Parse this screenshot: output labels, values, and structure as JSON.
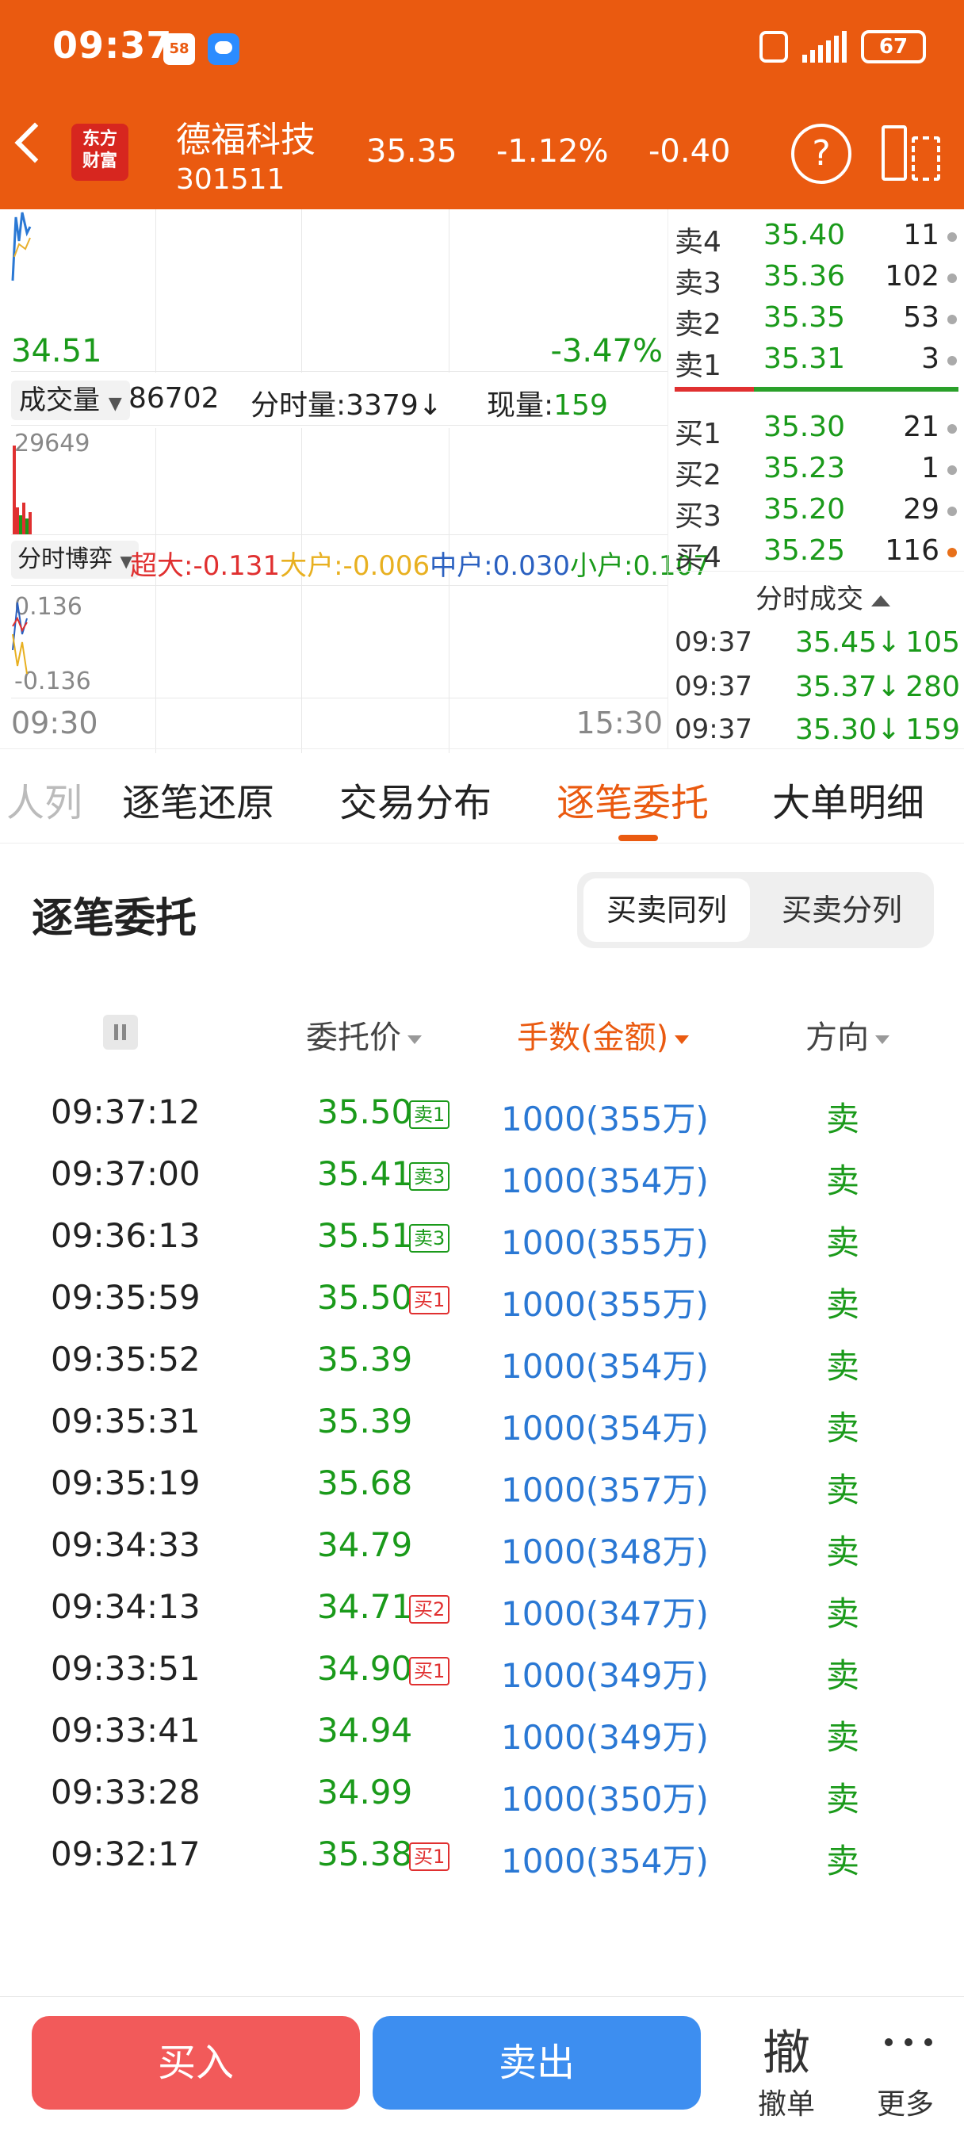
{
  "status_bar": {
    "time": "09:37",
    "app_badge": "58",
    "battery": "67"
  },
  "header": {
    "logo_line1": "东方",
    "logo_line2": "财富",
    "stock_name": "德福科技",
    "stock_code": "301511",
    "price": "35.35",
    "change_pct": "-1.12%",
    "change": "-0.40",
    "help_symbol": "?"
  },
  "chart": {
    "low_price": "34.51",
    "low_pct": "-3.47%",
    "volume_label": "成交量",
    "volume_total": "86702",
    "tick_volume": "分时量:3379",
    "tick_arrow": "↓",
    "now_volume_label": "现量:",
    "now_volume": "159",
    "volume_max": "29649",
    "game_label": "分时博弈",
    "game": {
      "super_label": "超大:",
      "super_val": "-0.131",
      "large_label": "大户:",
      "large_val": "-0.006",
      "mid_label": "中户:",
      "mid_val": "0.030",
      "small_label": "小户:",
      "small_val": "0.107"
    },
    "tick_up": "0.136",
    "tick_down": "-0.136",
    "time_start": "09:30",
    "time_end": "15:30"
  },
  "order_book": {
    "asks": [
      {
        "label": "卖4",
        "price": "35.40",
        "qty": "11"
      },
      {
        "label": "卖3",
        "price": "35.36",
        "qty": "102"
      },
      {
        "label": "卖2",
        "price": "35.35",
        "qty": "53"
      },
      {
        "label": "卖1",
        "price": "35.31",
        "qty": "3"
      }
    ],
    "bids": [
      {
        "label": "买1",
        "price": "35.30",
        "qty": "21"
      },
      {
        "label": "买2",
        "price": "35.23",
        "qty": "1"
      },
      {
        "label": "买3",
        "price": "35.20",
        "qty": "29"
      },
      {
        "label": "买4",
        "price": "35.25",
        "qty": "116"
      }
    ],
    "trades_title": "分时成交",
    "trades": [
      {
        "time": "09:37",
        "price": "35.45↓",
        "qty": "105"
      },
      {
        "time": "09:37",
        "price": "35.37↓",
        "qty": "280"
      },
      {
        "time": "09:37",
        "price": "35.30↓",
        "qty": "159"
      }
    ]
  },
  "tabs": [
    "队列",
    "逐笔还原",
    "交易分布",
    "逐笔委托",
    "大单明细"
  ],
  "tab_partial": "人列",
  "section": {
    "title": "逐笔委托",
    "seg_same": "买卖同列",
    "seg_split": "买卖分列",
    "col_price": "委托价",
    "col_qty": "手数(金额)",
    "col_dir": "方向"
  },
  "orders": [
    {
      "time": "09:37:12",
      "price": "35.50",
      "badge": "卖1",
      "badge_type": "s",
      "amount": "1000(355万)",
      "dir": "卖"
    },
    {
      "time": "09:37:00",
      "price": "35.41",
      "badge": "卖3",
      "badge_type": "s",
      "amount": "1000(354万)",
      "dir": "卖"
    },
    {
      "time": "09:36:13",
      "price": "35.51",
      "badge": "卖3",
      "badge_type": "s",
      "amount": "1000(355万)",
      "dir": "卖"
    },
    {
      "time": "09:35:59",
      "price": "35.50",
      "badge": "买1",
      "badge_type": "b",
      "amount": "1000(355万)",
      "dir": "卖"
    },
    {
      "time": "09:35:52",
      "price": "35.39",
      "badge": "",
      "badge_type": "",
      "amount": "1000(354万)",
      "dir": "卖"
    },
    {
      "time": "09:35:31",
      "price": "35.39",
      "badge": "",
      "badge_type": "",
      "amount": "1000(354万)",
      "dir": "卖"
    },
    {
      "time": "09:35:19",
      "price": "35.68",
      "badge": "",
      "badge_type": "",
      "amount": "1000(357万)",
      "dir": "卖"
    },
    {
      "time": "09:34:33",
      "price": "34.79",
      "badge": "",
      "badge_type": "",
      "amount": "1000(348万)",
      "dir": "卖"
    },
    {
      "time": "09:34:13",
      "price": "34.71",
      "badge": "买2",
      "badge_type": "b",
      "amount": "1000(347万)",
      "dir": "卖"
    },
    {
      "time": "09:33:51",
      "price": "34.90",
      "badge": "买1",
      "badge_type": "b",
      "amount": "1000(349万)",
      "dir": "卖"
    },
    {
      "time": "09:33:41",
      "price": "34.94",
      "badge": "",
      "badge_type": "",
      "amount": "1000(349万)",
      "dir": "卖"
    },
    {
      "time": "09:33:28",
      "price": "34.99",
      "badge": "",
      "badge_type": "",
      "amount": "1000(350万)",
      "dir": "卖"
    },
    {
      "time": "09:32:17",
      "price": "35.38",
      "badge": "买1",
      "badge_type": "b",
      "amount": "1000(354万)",
      "dir": "卖"
    }
  ],
  "bottom": {
    "buy": "买入",
    "sell": "卖出",
    "cancel_big": "撤",
    "cancel_label": "撤单",
    "more_label": "更多"
  },
  "colors": {
    "brand": "#ea5a10",
    "up": "#e03030",
    "down": "#1a9a1a",
    "amount": "#2a78d4"
  }
}
